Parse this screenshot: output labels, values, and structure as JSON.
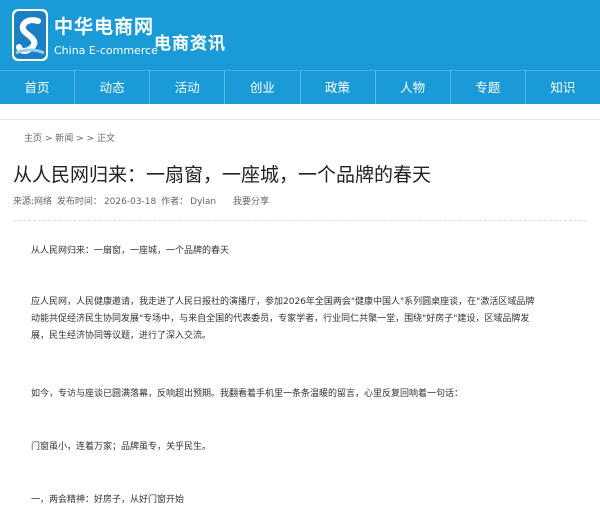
{
  "site": {
    "name": "中华电商网",
    "name_en": "China E-commerce",
    "section": "电商资讯",
    "brand_color": "#1a9bd7"
  },
  "nav": {
    "items": [
      "首页",
      "动态",
      "活动",
      "创业",
      "政策",
      "人物",
      "专题",
      "知识"
    ]
  },
  "breadcrumb": {
    "home": "主页",
    "sep1": " > ",
    "news": "新闻",
    "sep2": " > > ",
    "current": "正文"
  },
  "article": {
    "title": "从人民网归来：一扇窗，一座城，一个品牌的春天",
    "source_label": "来源:网络",
    "published_label": "发布时间：",
    "published_date": "2026-03-18",
    "author_label": "作者：",
    "author": "Dylan",
    "share_label": "我要分享",
    "paragraphs": [
      "从人民网归来：一扇窗，一座城，一个品牌的春天",
      "应人民网，人民健康邀请，我走进了人民日报社的演播厅，参加2026年全国两会\"健康中国人\"系列圆桌座谈，在\"激活区域品牌动能共促经济民生协同发展\"专场中，与来自全国的代表委员，专家学者，行业同仁共聚一堂，围绕\"好房子\"建设，区域品牌发展，民生经济协同等议题，进行了深入交流。",
      "如今，专访与座谈已圆满落幕，反响超出预期。我翻看着手机里一条条温暖的留言，心里反复回响着一句话：",
      "门窗虽小，连着万家；品牌虽专，关乎民生。",
      "一，两会精神：好房子，从好门窗开始"
    ]
  }
}
